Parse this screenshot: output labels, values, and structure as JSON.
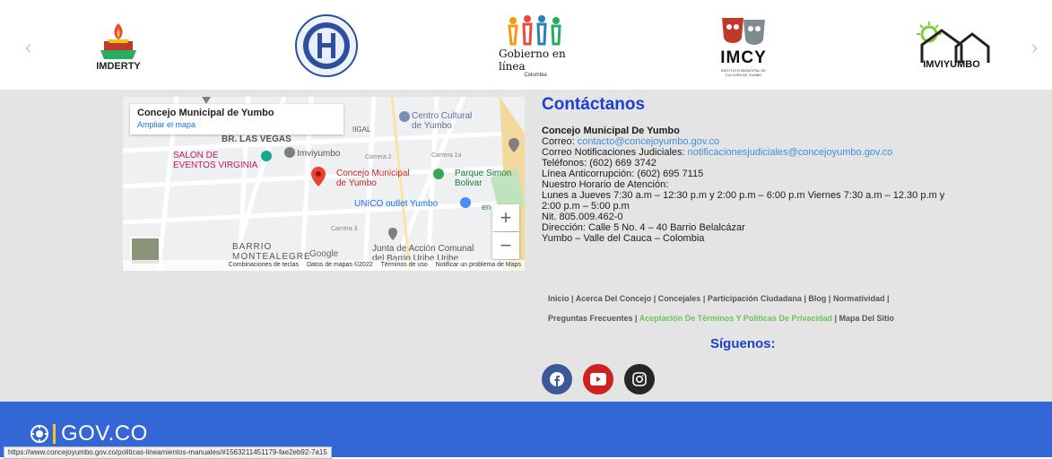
{
  "logos": [
    {
      "name": "IMDERTY",
      "caption": "IMDERTY"
    },
    {
      "name": "Hospital",
      "caption": ""
    },
    {
      "name": "Gobierno en linea",
      "caption": "Gobierno en línea",
      "sub": "Colombia"
    },
    {
      "name": "IMCY",
      "caption": "IMCY",
      "sub": "INSTITUTO MUNICIPAL DE CULTURA DE YUMBO"
    },
    {
      "name": "IMVIYUMBO",
      "caption": "IMVIYUMBO"
    }
  ],
  "carousel": {
    "prev": "‹",
    "next": "›"
  },
  "map": {
    "card_title": "Concejo Municipal de Yumbo",
    "card_link": "Ampliar el mapa",
    "zoom_in": "+",
    "zoom_out": "−",
    "labels": {
      "centro": "Centro Cultural\nde Yumbo",
      "barrio_vegas": "BR. LAS VEGAS",
      "imviyumbo": "Imviyumbo",
      "salon": "SALON DE\nEVENTOS VIRGINIA",
      "concejo": "Concejo Municipal\nde Yumbo",
      "parque": "Parque Simon\nBolivar",
      "unico": "UNICO outlet Yumbo",
      "barrio_monte": "BARRIO\nMONTEALEGRE",
      "junta": "Junta de Acción Comunal\ndel Barrio Uribe Uribe",
      "google": "Google",
      "carrera_2": "Carrera 2",
      "carrera_1a": "Carrera 1a",
      "carrera_3": "Carrera 3",
      "gal": "IIGAL",
      "en": "en"
    },
    "footer": [
      "Combinaciones de teclas",
      "Datos de mapas ©2022",
      "Términos de uso",
      "Notificar un problema de Maps"
    ]
  },
  "contact": {
    "title": "Contáctanos",
    "org": "Concejo Municipal De Yumbo",
    "correo_label": "Correo:",
    "correo": "contacto@concejoyumbo.gov.co",
    "judicial_label": "Correo Notificaciones Judiciales:",
    "judicial": "notificacionesjudiciales@concejoyumbo.gov.co",
    "telefonos": "Teléfonos: (602) 669 3742",
    "anticorrupcion": "Línea Anticorrupción: (602) 695 7115",
    "horario_label": "Nuestro Horario de Atención:",
    "horario": "Lunes a Jueves 7:30 a.m – 12:30 p.m y 2:00 p.m – 6:00 p.m Viernes 7:30 a.m – 12.30 p.m y 2:00 p.m – 5:00 p.m",
    "nit": "Nit. 805.009.462-0",
    "direccion": "Dirección: Calle 5 No. 4 – 40 Barrio Belalcázar",
    "ciudad": "Yumbo – Valle del Cauca – Colombia"
  },
  "footer_links": [
    "Inicio",
    "Acerca Del Concejo",
    "Concejales",
    "Participación Ciudadana",
    "Blog",
    "Normatividad",
    "Preguntas Frecuentes",
    "Aceptación De Términos Y Políticas De Privacidad",
    "Mapa Del Sitio"
  ],
  "siguenos": "Síguenos:",
  "social": [
    {
      "name": "facebook",
      "color": "#3b5998"
    },
    {
      "name": "youtube",
      "color": "#cd201f"
    },
    {
      "name": "instagram",
      "color": "#262626"
    }
  ],
  "gov": {
    "text": "GOV.CO",
    "bar_color": "#3367d6"
  },
  "status_url": "https://www.concejoyumbo.gov.co/politicas-lineamientos-manuales/#1563211451179-fae2eb92-7a15"
}
